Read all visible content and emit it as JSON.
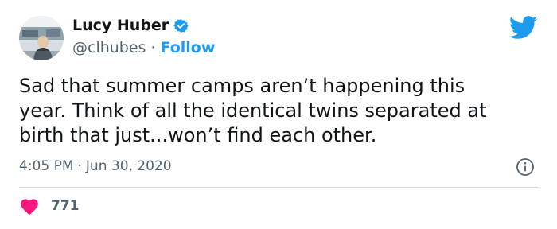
{
  "author": {
    "name": "Lucy Huber",
    "handle": "@clhubes",
    "separator": "·",
    "follow_label": "Follow"
  },
  "tweet": {
    "text": "Sad that summer camps aren’t happening this\nyear. Think of all the identical twins separated at\nbirth that just...won’t find each other.",
    "time": "4:05 PM",
    "meta_separator": "·",
    "date": "Jun 30, 2020"
  },
  "stats": {
    "likes": "771"
  },
  "colors": {
    "accent": "#1d9bf0",
    "heart": "#f91880",
    "muted": "#536471",
    "text": "#0f1419"
  },
  "icons": {
    "verified": "verified-badge-icon",
    "brand": "twitter-bird-icon",
    "info": "info-icon",
    "like": "heart-icon"
  }
}
